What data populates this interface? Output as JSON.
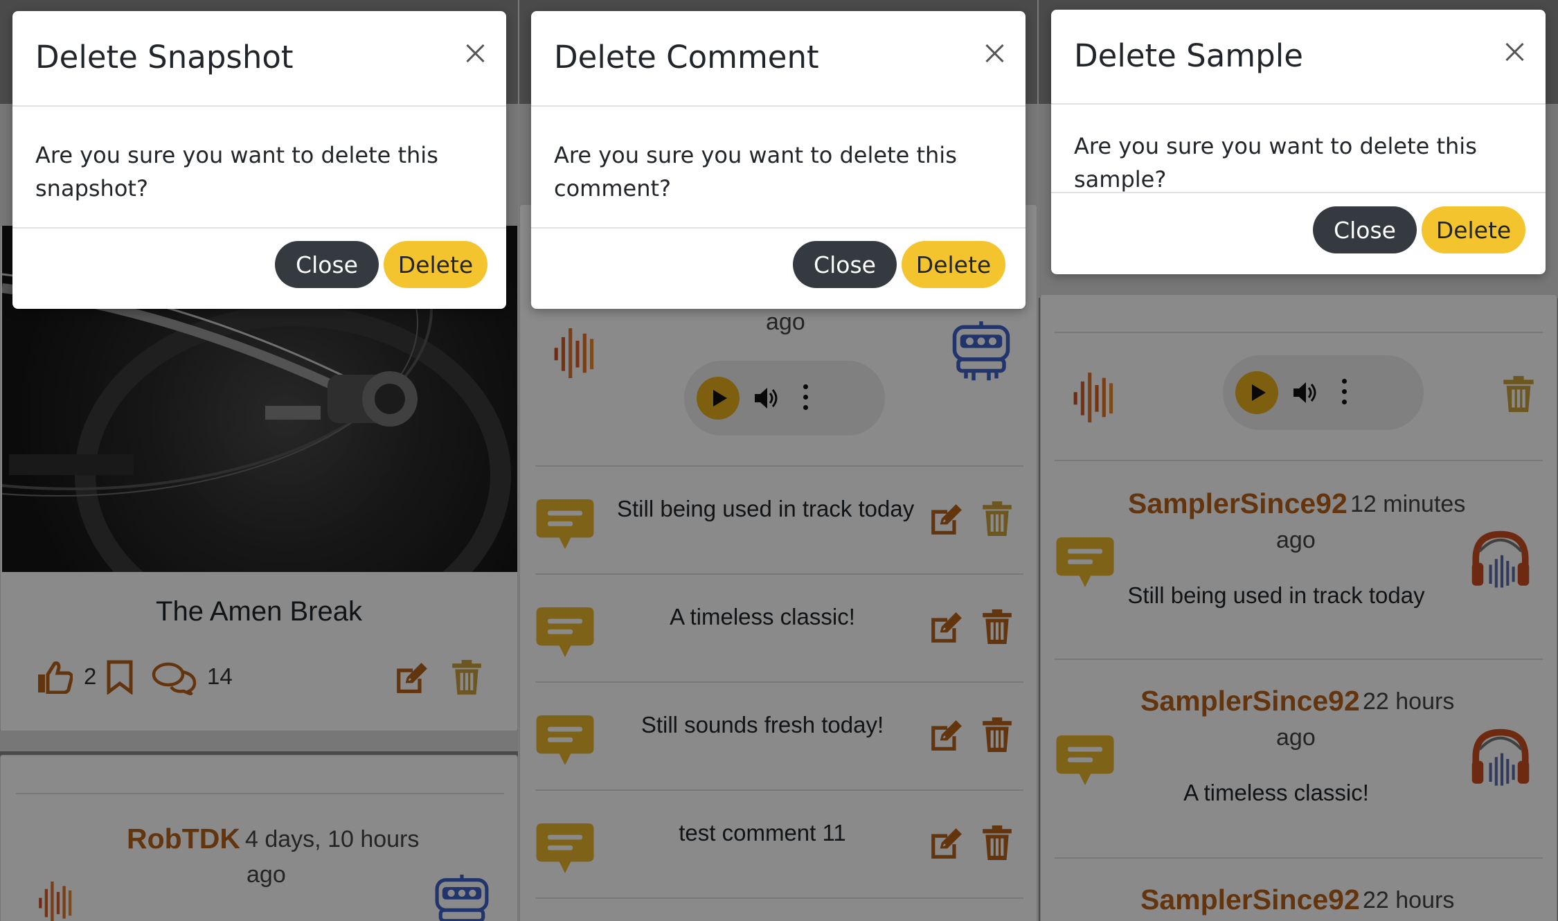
{
  "snapshot_modal": {
    "title": "Delete Snapshot",
    "body": "Are you sure you want to delete this snapshot?",
    "close_label": "Close",
    "delete_label": "Delete"
  },
  "comment_modal": {
    "title": "Delete Comment",
    "body": "Are you sure you want to delete this comment?",
    "close_label": "Close",
    "delete_label": "Delete"
  },
  "sample_modal": {
    "title": "Delete Sample",
    "body": "Are you sure you want to delete this sample?",
    "close_label": "Close",
    "delete_label": "Delete"
  },
  "snapshot_card": {
    "title": "The Amen Break",
    "likes": "2",
    "comments": "14"
  },
  "snapshot_sample": {
    "username": "RobTDK",
    "time": "4 days, 10 hours",
    "time_suffix": "ago"
  },
  "comment_page": {
    "sample_time_suffix": "ago",
    "comments": [
      {
        "text": "Still being used in track today"
      },
      {
        "text": "A timeless classic!"
      },
      {
        "text": "Still sounds fresh today!"
      },
      {
        "text": "test comment 11"
      }
    ]
  },
  "sample_page": {
    "comments": [
      {
        "username": "SamplerSince92",
        "time": "12 minutes",
        "time_suffix": "ago",
        "text": "Still being used in track today"
      },
      {
        "username": "SamplerSince92",
        "time": "22 hours",
        "time_suffix": "ago",
        "text": "A timeless classic!"
      },
      {
        "username": "SamplerSince92",
        "time": "22 hours"
      }
    ]
  },
  "colors": {
    "accent_yellow": "#f4c42e",
    "brand_orange": "#b8621a",
    "dark_button": "#343a40",
    "overlay": "rgba(0,0,0,0.46)"
  },
  "icons": {
    "like": "thumbs-up-icon",
    "bookmark": "bookmark-icon",
    "comments": "comments-icon",
    "edit": "edit-icon",
    "delete": "trash-icon",
    "waveform": "waveform-icon",
    "robot": "robot-avatar-icon",
    "headphones": "headphones-avatar-icon",
    "comment_bubble": "comment-bubble-icon"
  }
}
